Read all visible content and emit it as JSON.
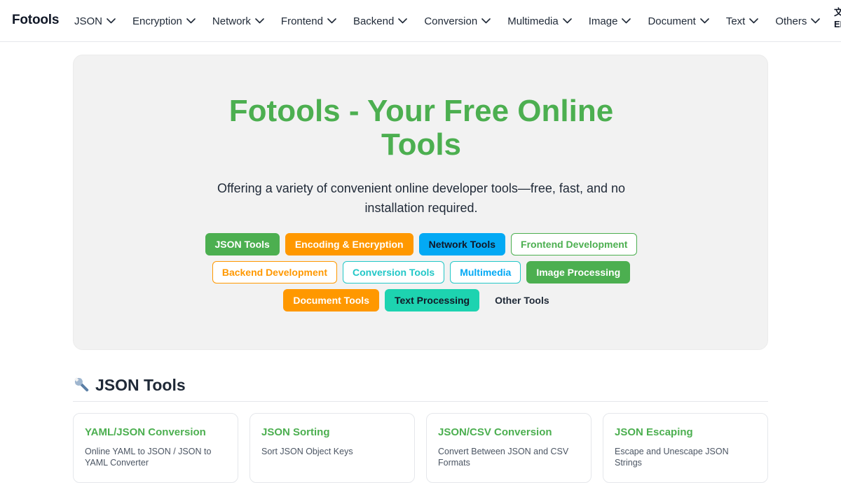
{
  "nav": {
    "brand": "Fotools",
    "items": [
      {
        "label": "JSON"
      },
      {
        "label": "Encryption"
      },
      {
        "label": "Network"
      },
      {
        "label": "Frontend"
      },
      {
        "label": "Backend"
      },
      {
        "label": "Conversion"
      },
      {
        "label": "Multimedia"
      },
      {
        "label": "Image"
      },
      {
        "label": "Document"
      },
      {
        "label": "Text"
      },
      {
        "label": "Others"
      }
    ],
    "language": {
      "glyph": "文",
      "code": "EN"
    }
  },
  "hero": {
    "title": "Fotools - Your Free Online Tools",
    "subtitle": "Offering a variety of convenient online developer tools—free, fast, and no installation required.",
    "tags": [
      {
        "label": "JSON Tools",
        "style": "solid-green"
      },
      {
        "label": "Encoding & Encryption",
        "style": "solid-orange"
      },
      {
        "label": "Network Tools",
        "style": "solid-blue"
      },
      {
        "label": "Frontend Development",
        "style": "out-green"
      },
      {
        "label": "Backend Development",
        "style": "out-orange"
      },
      {
        "label": "Conversion Tools",
        "style": "out-teal"
      },
      {
        "label": "Multimedia",
        "style": "out-blue"
      },
      {
        "label": "Image Processing",
        "style": "solid-green"
      },
      {
        "label": "Document Tools",
        "style": "solid-orange"
      },
      {
        "label": "Text Processing",
        "style": "solid-teal"
      },
      {
        "label": "Other Tools",
        "style": "ghost"
      }
    ]
  },
  "section": {
    "icon": "wrench-icon",
    "title": "JSON Tools",
    "cards": [
      {
        "title": "YAML/JSON Conversion",
        "description": "Online YAML to JSON / JSON to YAML Converter"
      },
      {
        "title": "JSON Sorting",
        "description": "Sort JSON Object Keys"
      },
      {
        "title": "JSON/CSV Conversion",
        "description": "Convert Between JSON and CSV Formats"
      },
      {
        "title": "JSON Escaping",
        "description": "Escape and Unescape JSON Strings"
      }
    ]
  },
  "colors": {
    "accent_green": "#4caf50",
    "accent_orange": "#ff9800",
    "accent_blue": "#03a9f4",
    "accent_teal": "#1dd3b0",
    "hero_bg": "#f2f2f2"
  }
}
